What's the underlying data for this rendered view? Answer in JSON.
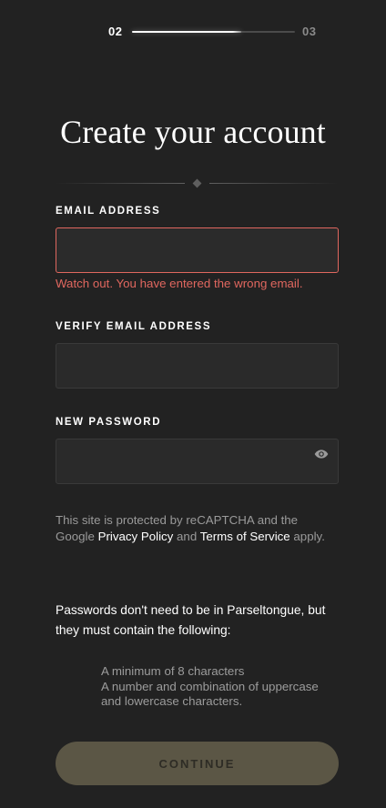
{
  "progress": {
    "current_step": "02",
    "next_step": "03",
    "fill_fraction": 0.67
  },
  "title": "Create your account",
  "form": {
    "email": {
      "label": "EMAIL ADDRESS",
      "value": "",
      "error": "Watch out. You have entered the wrong email."
    },
    "verify_email": {
      "label": "VERIFY EMAIL ADDRESS",
      "value": ""
    },
    "password": {
      "label": "NEW PASSWORD",
      "value": "",
      "toggle_icon": "eye-icon"
    }
  },
  "legal": {
    "prefix": "This site is protected by reCAPTCHA and the Google ",
    "privacy_link": "Privacy Policy",
    "and": " and ",
    "terms_link": "Terms of Service",
    "suffix": " apply."
  },
  "requirements": {
    "intro": "Passwords don't need to be in Parseltongue, but they must contain the following:",
    "items": [
      "A minimum of 8 characters",
      "A number and combination of uppercase and lowercase characters."
    ]
  },
  "continue_label": "CONTINUE",
  "colors": {
    "background": "#222222",
    "error": "#e0675f",
    "button": "#5b5645",
    "muted_text": "#9a9a9a"
  }
}
